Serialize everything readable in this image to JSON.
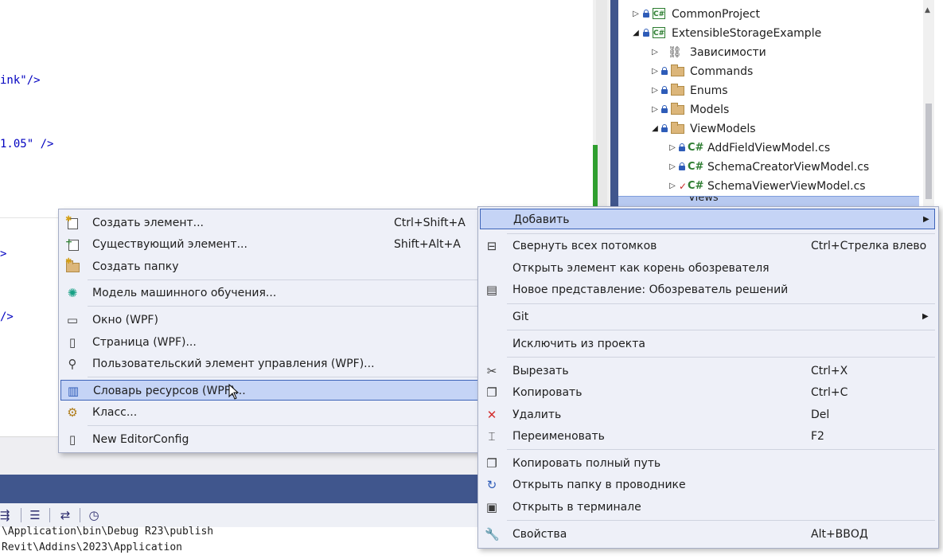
{
  "editor": {
    "lines": [
      {
        "text": "ink\"/>"
      },
      {
        "text": "1.05\" />"
      },
      {
        "text": ">"
      },
      {
        "text": "/>"
      }
    ]
  },
  "output": {
    "lines": [
      "\\Application\\bin\\Debug R23\\publish",
      "Revit\\Addins\\2023\\Application"
    ]
  },
  "solution_explorer": {
    "items": [
      {
        "label": "CommonProject"
      },
      {
        "label": "ExtensibleStorageExample"
      },
      {
        "label": "Зависимости"
      },
      {
        "label": "Commands"
      },
      {
        "label": "Enums"
      },
      {
        "label": "Models"
      },
      {
        "label": "ViewModels"
      },
      {
        "label": "AddFieldViewModel.cs"
      },
      {
        "label": "SchemaCreatorViewModel.cs"
      },
      {
        "label": "SchemaViewerViewModel.cs"
      },
      {
        "label": "Views"
      }
    ]
  },
  "add_submenu": {
    "items": [
      {
        "label": "Создать элемент...",
        "shortcut": "Ctrl+Shift+A"
      },
      {
        "label": "Существующий элемент...",
        "shortcut": "Shift+Alt+A"
      },
      {
        "label": "Создать папку",
        "shortcut": ""
      },
      {
        "label": "Модель машинного обучения...",
        "shortcut": ""
      },
      {
        "label": "Окно (WPF)",
        "shortcut": ""
      },
      {
        "label": "Страница (WPF)...",
        "shortcut": ""
      },
      {
        "label": "Пользовательский элемент управления (WPF)...",
        "shortcut": ""
      },
      {
        "label": "Словарь ресурсов (WPF)...",
        "shortcut": ""
      },
      {
        "label": "Класс...",
        "shortcut": ""
      },
      {
        "label": "New EditorConfig",
        "shortcut": ""
      }
    ]
  },
  "context_menu": {
    "items": [
      {
        "label": "Добавить",
        "shortcut": ""
      },
      {
        "label": "Свернуть всех потомков",
        "shortcut": "Ctrl+Стрелка влево"
      },
      {
        "label": "Открыть элемент как корень обозревателя",
        "shortcut": ""
      },
      {
        "label": "Новое представление: Обозреватель решений",
        "shortcut": ""
      },
      {
        "label": "Git",
        "shortcut": ""
      },
      {
        "label": "Исключить из проекта",
        "shortcut": ""
      },
      {
        "label": "Вырезать",
        "shortcut": "Ctrl+X"
      },
      {
        "label": "Копировать",
        "shortcut": "Ctrl+C"
      },
      {
        "label": "Удалить",
        "shortcut": "Del"
      },
      {
        "label": "Переименовать",
        "shortcut": "F2"
      },
      {
        "label": "Копировать полный путь",
        "shortcut": ""
      },
      {
        "label": "Открыть папку в проводнике",
        "shortcut": ""
      },
      {
        "label": "Открыть в терминале",
        "shortcut": ""
      },
      {
        "label": "Свойства",
        "shortcut": "Alt+ВВОД"
      }
    ]
  },
  "icons": {
    "proj_badge": "C#",
    "cs_badge": "C#",
    "submenu_arrow": "▶"
  },
  "colors": {
    "accent": "#40568d",
    "highlight": "#c5d4f6",
    "highlight_border": "#3d63b8",
    "change_marker": "#2f9e2f"
  }
}
